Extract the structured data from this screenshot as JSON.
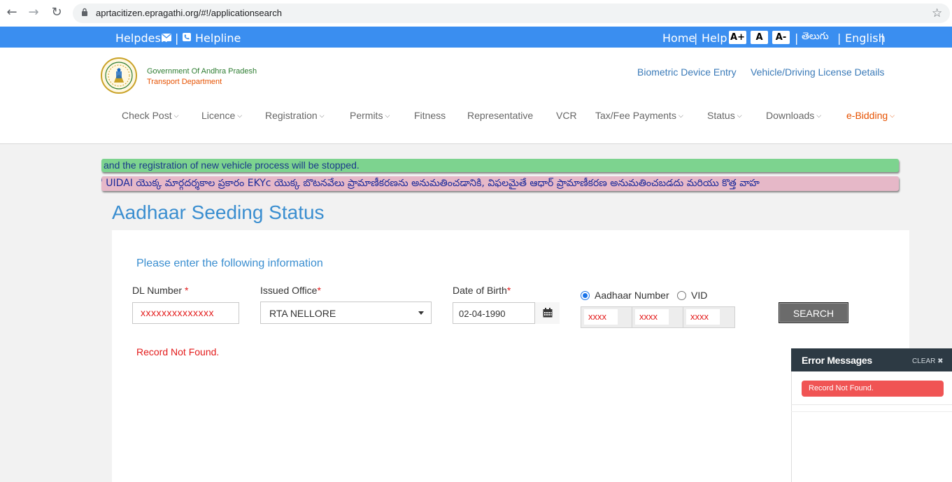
{
  "browser": {
    "url": "aprtacitizen.epragathi.org/#!/applicationsearch"
  },
  "topbar": {
    "helpdesk": "Helpdesk",
    "helpline": "Helpline",
    "home": "Home",
    "help": "Help",
    "font_increase": "A+",
    "font_normal": "A",
    "font_decrease": "A-",
    "telugu": "తెలుగు",
    "english": "English"
  },
  "header": {
    "gov_name": "Government Of Andhra Pradesh",
    "dept_name": "Transport Department",
    "links": [
      "Biometric Device Entry",
      "Vehicle/Driving License Details"
    ],
    "menu": [
      {
        "label": "Check Post",
        "dropdown": true
      },
      {
        "label": "Licence",
        "dropdown": true
      },
      {
        "label": "Registration",
        "dropdown": true
      },
      {
        "label": "Permits",
        "dropdown": true
      },
      {
        "label": "Fitness",
        "dropdown": false
      },
      {
        "label": "Representative",
        "dropdown": false
      },
      {
        "label": "VCR",
        "dropdown": false
      },
      {
        "label": "Tax/Fee Payments",
        "dropdown": true
      },
      {
        "label": "Status",
        "dropdown": true
      },
      {
        "label": "Downloads",
        "dropdown": true
      },
      {
        "label": "e-Bidding",
        "dropdown": true
      }
    ]
  },
  "marquee": {
    "line1": "and the registration of new vehicle process will be stopped.",
    "line2": "' UIDAI యొక్క మార్గదర్శకాల ప్రకారం EKYc యొక్క బొటనవేలు ప్రామాణీకరణను అనుమతించడానికి, విఫలమైతే ఆధార్ ప్రామాణీకరణ అనుమతించబడదు మరియు కొత్త వాహ"
  },
  "page": {
    "title": "Aadhaar Seeding Status",
    "instruction": "Please enter the following information"
  },
  "form": {
    "dl_label": "DL Number",
    "dl_value": "xxxxxxxxxxxxxx",
    "office_label": "Issued Office",
    "office_value": "RTA NELLORE",
    "dob_label": "Date of Birth",
    "dob_value": "02-04-1990",
    "radio_aadhaar": "Aadhaar Number",
    "radio_vid": "VID",
    "aadhaar_seg1": "xxxx",
    "aadhaar_seg2": "xxxx",
    "aadhaar_seg3": "xxxx",
    "search_label": "SEARCH",
    "required_mark": "*"
  },
  "result": {
    "message": "Record Not Found."
  },
  "error_panel": {
    "title": "Error Messages",
    "clear_label": "CLEAR ✖",
    "message": "Record Not Found."
  },
  "colors": {
    "topbar": "#3a8ef0",
    "accent": "#3a8ed0",
    "error": "#e31b1b",
    "bidding": "#e65100"
  }
}
